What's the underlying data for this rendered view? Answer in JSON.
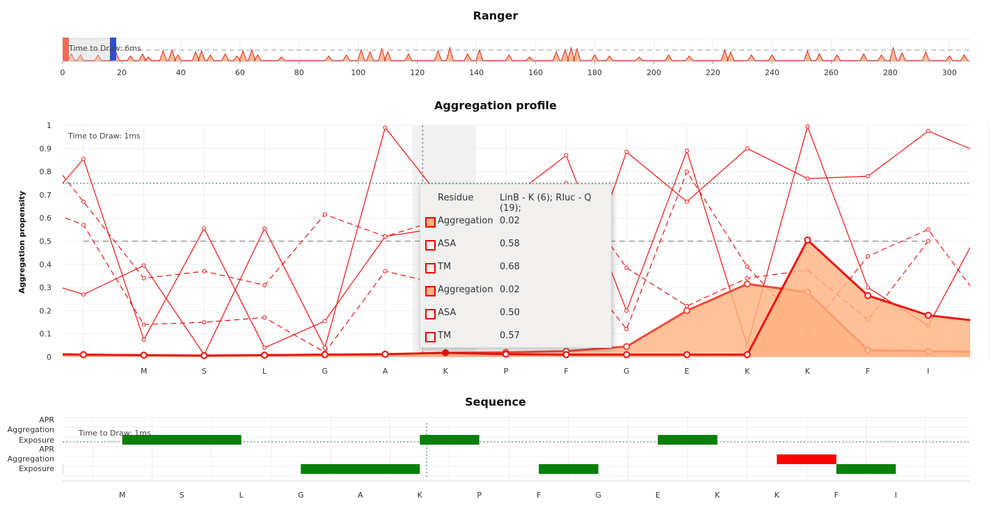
{
  "ranger": {
    "title": "Ranger",
    "time_to_draw": "Time to Draw: 6ms",
    "x_ticks": [
      "0",
      "20",
      "40",
      "60",
      "80",
      "100",
      "120",
      "140",
      "160",
      "180",
      "200",
      "220",
      "240",
      "260",
      "280",
      "300"
    ]
  },
  "profile": {
    "title": "Aggregation profile",
    "time_to_draw": "Time to Draw: 1ms",
    "ylabel": "Aggregation propensity"
  },
  "sequence_panel": {
    "title": "Sequence",
    "time_to_draw": "Time to Draw: 1ms",
    "track_labels_top": [
      "APR",
      "Aggregation",
      "Exposure"
    ],
    "track_labels_bottom": [
      "APR",
      "Aggregation",
      "Exposure"
    ]
  },
  "tooltip": {
    "residue_label": "Residue",
    "residue_value": "LinB - K (6); Rluc - Q (19);",
    "rows": [
      {
        "label": "Aggregation",
        "value": "0.02",
        "filled": true
      },
      {
        "label": "ASA",
        "value": "0.58",
        "filled": false
      },
      {
        "label": "TM",
        "value": "0.68",
        "filled": false
      },
      {
        "label": "Aggregation",
        "value": "0.02",
        "filled": true
      },
      {
        "label": "ASA",
        "value": "0.50",
        "filled": false
      },
      {
        "label": "TM",
        "value": "0.57",
        "filled": false
      }
    ]
  },
  "colors": {
    "red": "#ee1111",
    "fill": "#ffb27f",
    "green": "#0a7f0a",
    "apr_red": "#ff0000",
    "highlight": "#f2f2f2"
  },
  "chart_data": [
    {
      "type": "area",
      "title": "Ranger",
      "xlim": [
        0,
        307
      ],
      "x_ticks": [
        0,
        20,
        40,
        60,
        80,
        100,
        120,
        140,
        160,
        180,
        200,
        220,
        240,
        260,
        280,
        300
      ],
      "threshold": 0.5,
      "brush": [
        0,
        16
      ],
      "peaks": [
        [
          3,
          0.35
        ],
        [
          6,
          0.3
        ],
        [
          12,
          0.3
        ],
        [
          18,
          0.45
        ],
        [
          23,
          0.25
        ],
        [
          27,
          0.35
        ],
        [
          29,
          0.2
        ],
        [
          34,
          0.5
        ],
        [
          37,
          0.55
        ],
        [
          39,
          0.3
        ],
        [
          45,
          0.45
        ],
        [
          47,
          0.5
        ],
        [
          50,
          0.3
        ],
        [
          55,
          0.35
        ],
        [
          59,
          0.25
        ],
        [
          61,
          0.5
        ],
        [
          64,
          0.55
        ],
        [
          66,
          0.3
        ],
        [
          74,
          0.2
        ],
        [
          90,
          0.25
        ],
        [
          96,
          0.3
        ],
        [
          101,
          0.55
        ],
        [
          104,
          0.45
        ],
        [
          108,
          0.6
        ],
        [
          110,
          0.45
        ],
        [
          117,
          0.35
        ],
        [
          127,
          0.5
        ],
        [
          131,
          0.65
        ],
        [
          137,
          0.35
        ],
        [
          141,
          0.55
        ],
        [
          151,
          0.3
        ],
        [
          158,
          0.2
        ],
        [
          167,
          0.45
        ],
        [
          170,
          0.55
        ],
        [
          172,
          0.65
        ],
        [
          174,
          0.6
        ],
        [
          180,
          0.3
        ],
        [
          185,
          0.25
        ],
        [
          195,
          0.2
        ],
        [
          205,
          0.3
        ],
        [
          212,
          0.25
        ],
        [
          224,
          0.55
        ],
        [
          226,
          0.45
        ],
        [
          233,
          0.3
        ],
        [
          240,
          0.3
        ],
        [
          252,
          0.5
        ],
        [
          256,
          0.35
        ],
        [
          262,
          0.3
        ],
        [
          271,
          0.35
        ],
        [
          277,
          0.3
        ],
        [
          281,
          0.65
        ],
        [
          284,
          0.4
        ],
        [
          292,
          0.45
        ],
        [
          300,
          0.25
        ],
        [
          305,
          0.3
        ]
      ]
    },
    {
      "type": "line",
      "title": "Aggregation profile",
      "ylabel": "Aggregation propensity",
      "ylim": [
        0,
        1
      ],
      "y_ticks": [
        "0",
        "0.1",
        "0.2",
        "0.3",
        "0.4",
        "0.5",
        "0.6",
        "0.7",
        "0.8",
        "0.9",
        "1"
      ],
      "categories": [
        "M",
        "S",
        "L",
        "G",
        "A",
        "K",
        "P",
        "F",
        "G",
        "E",
        "K",
        "K",
        "F",
        "I"
      ],
      "x": [
        -1,
        0,
        1,
        2,
        3,
        4,
        5,
        6,
        7,
        8,
        9,
        10,
        11,
        12,
        13,
        14
      ],
      "thresholds": [
        0.5,
        0.75
      ],
      "highlight_x": 6,
      "series": [
        {
          "style": "area-thick",
          "values": [
            0.015,
            0.01,
            0.008,
            0.006,
            0.008,
            0.01,
            0.012,
            0.018,
            0.02,
            0.025,
            0.045,
            0.2,
            0.315,
            0.28,
            0.03,
            0.025,
            0.022
          ]
        },
        {
          "style": "area-thick",
          "values": [
            0.015,
            0.01,
            0.008,
            0.006,
            0.008,
            0.01,
            0.012,
            0.018,
            0.012,
            0.01,
            0.01,
            0.01,
            0.01,
            0.505,
            0.265,
            0.18,
            0.15
          ]
        },
        {
          "style": "solid",
          "values": [
            0.35,
            0.27,
            0.395,
            0.01,
            0.555,
            0.04,
            0.99,
            0.66,
            0.67,
            0.87,
            0.2,
            0.89,
            0.05,
            0.995,
            0.3,
            0.135,
            0.62
          ]
        },
        {
          "style": "dashed",
          "values": [
            0.67,
            0.57,
            0.14,
            0.15,
            0.17,
            0.02,
            0.37,
            0.31,
            0.54,
            0.45,
            0.12,
            0.8,
            0.39,
            0.11,
            0.435,
            0.55,
            0.2,
            0.52
          ]
        },
        {
          "style": "solid",
          "values": [
            0.55,
            0.855,
            0.075,
            0.555,
            0.04,
            0.155,
            0.52,
            0.56,
            0.3,
            0.14,
            0.885,
            0.67,
            0.9,
            0.77,
            0.78,
            0.975,
            0.865
          ]
        },
        {
          "style": "dashed",
          "values": [
            1.0,
            0.67,
            0.34,
            0.37,
            0.31,
            0.615,
            0.52,
            0.6,
            0.15,
            0.75,
            0.385,
            0.22,
            0.34,
            0.375,
            0.16,
            0.5
          ]
        }
      ]
    },
    {
      "type": "bar",
      "title": "Sequence",
      "categories": [
        "M",
        "S",
        "L",
        "G",
        "A",
        "K",
        "P",
        "F",
        "G",
        "E",
        "K",
        "K",
        "F",
        "I"
      ],
      "tracks": {
        "top_exposure": [
          [
            0.5,
            2.5
          ],
          [
            5.5,
            6.5
          ],
          [
            9.5,
            10.5
          ]
        ],
        "bottom_apr": [
          [
            11.5,
            12.5
          ]
        ],
        "bottom_exposure": [
          [
            -1.5,
            -0.5
          ],
          [
            3.5,
            5.5
          ],
          [
            7.5,
            8.5
          ],
          [
            12.5,
            13.5
          ]
        ]
      }
    }
  ]
}
